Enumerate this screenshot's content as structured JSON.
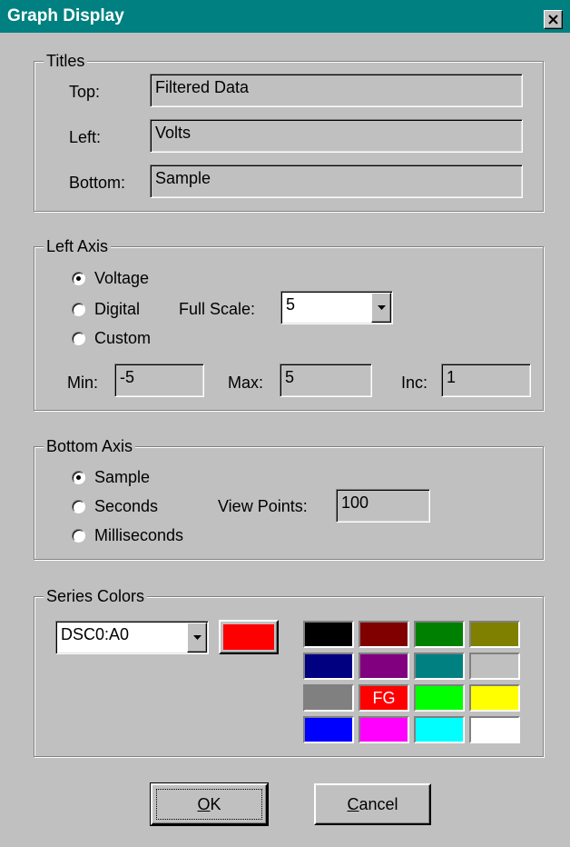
{
  "window": {
    "title": "Graph Display"
  },
  "titles": {
    "group_label": "Titles",
    "top_label": "Top:",
    "top_value": "Filtered Data",
    "left_label": "Left:",
    "left_value": "Volts",
    "bottom_label": "Bottom:",
    "bottom_value": "Sample"
  },
  "left_axis": {
    "group_label": "Left Axis",
    "options": [
      "Voltage",
      "Digital",
      "Custom"
    ],
    "selected": "Voltage",
    "full_scale_label": "Full Scale:",
    "full_scale_value": "5",
    "min_label": "Min:",
    "min_value": "-5",
    "max_label": "Max:",
    "max_value": "5",
    "inc_label": "Inc:",
    "inc_value": "1"
  },
  "bottom_axis": {
    "group_label": "Bottom Axis",
    "options": [
      "Sample",
      "Seconds",
      "Milliseconds"
    ],
    "selected": "Sample",
    "view_points_label": "View Points:",
    "view_points_value": "100"
  },
  "series_colors": {
    "group_label": "Series Colors",
    "series_value": "DSC0:A0",
    "current_color": "#ff0000",
    "fg_label": "FG",
    "palette": [
      "#000000",
      "#800000",
      "#008000",
      "#808000",
      "#000080",
      "#800080",
      "#008080",
      "#c0c0c0",
      "#808080",
      "#ff0000",
      "#00ff00",
      "#ffff00",
      "#0000ff",
      "#ff00ff",
      "#00ffff",
      "#ffffff"
    ]
  },
  "buttons": {
    "ok_mnemonic": "O",
    "ok_rest": "K",
    "cancel_mnemonic": "C",
    "cancel_rest": "ancel"
  },
  "icons": {
    "close": "close-icon",
    "dropdown": "chevron-down-icon"
  }
}
